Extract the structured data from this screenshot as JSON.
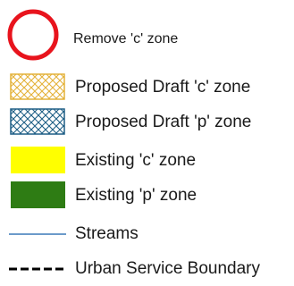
{
  "legend": {
    "items": [
      {
        "id": "remove-c-zone",
        "label": "Remove 'c' zone",
        "symbol": "circle-outline",
        "color": "#e8141d"
      },
      {
        "id": "proposed-draft-c-zone",
        "label": "Proposed Draft 'c' zone",
        "symbol": "crosshatch-box",
        "color": "#e4b23a"
      },
      {
        "id": "proposed-draft-p-zone",
        "label": "Proposed Draft 'p' zone",
        "symbol": "crosshatch-box",
        "color": "#1f5f86"
      },
      {
        "id": "existing-c-zone",
        "label": "Existing 'c' zone",
        "symbol": "filled-box",
        "color": "#ffff00"
      },
      {
        "id": "existing-p-zone",
        "label": "Existing 'p' zone",
        "symbol": "filled-box",
        "color": "#2e7c14"
      },
      {
        "id": "streams",
        "label": "Streams",
        "symbol": "line",
        "color": "#3b78b8"
      },
      {
        "id": "urban-service-boundary",
        "label": "Urban Service Boundary",
        "symbol": "dashed-line",
        "color": "#000000"
      }
    ]
  }
}
